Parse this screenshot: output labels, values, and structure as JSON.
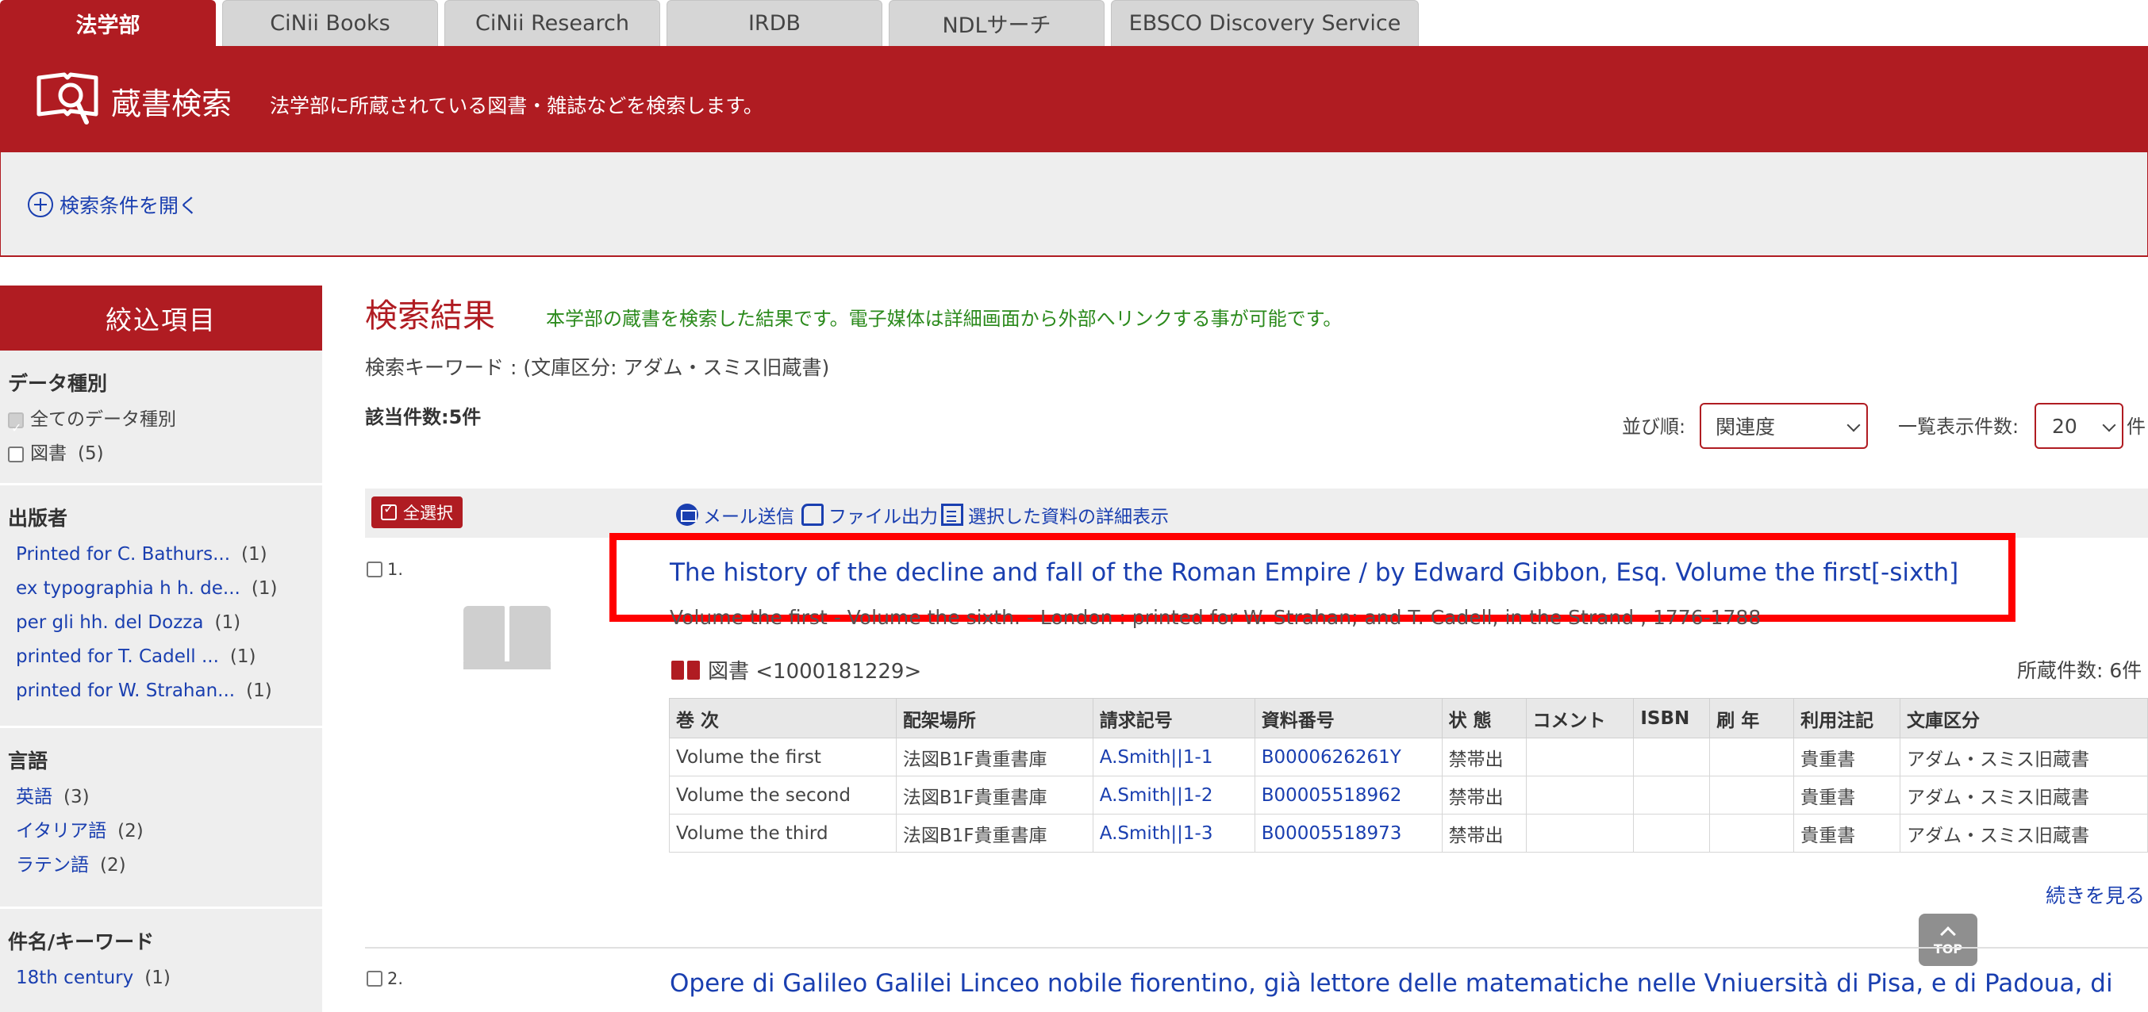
{
  "tabs": [
    {
      "label": "法学部",
      "active": true
    },
    {
      "label": "CiNii Books",
      "active": false
    },
    {
      "label": "CiNii Research",
      "active": false
    },
    {
      "label": "IRDB",
      "active": false
    },
    {
      "label": "NDLサーチ",
      "active": false
    },
    {
      "label": "EBSCO Discovery Service",
      "active": false
    }
  ],
  "header": {
    "title": "蔵書検索",
    "description": "法学部に所蔵されている図書・雑誌などを検索します。",
    "icon": "search-book-icon"
  },
  "conditions": {
    "open_label": "検索条件を開く"
  },
  "sidebar": {
    "heading": "絞込項目",
    "facets": [
      {
        "title": "データ種別",
        "items": [
          {
            "label": "全てのデータ種別",
            "count": "",
            "checkbox": true,
            "checked": true
          },
          {
            "label": "図書",
            "count": "(5)",
            "checkbox": true,
            "checked": false
          }
        ]
      },
      {
        "title": "出版者",
        "items": [
          {
            "label": "Printed for C. Bathurs...",
            "count": "(1)"
          },
          {
            "label": "ex typographia h h. de...",
            "count": "(1)"
          },
          {
            "label": "per gli hh. del Dozza",
            "count": "(1)"
          },
          {
            "label": "printed for T. Cadell ...",
            "count": "(1)"
          },
          {
            "label": "printed for W. Strahan...",
            "count": "(1)"
          }
        ]
      },
      {
        "title": "言語",
        "items": [
          {
            "label": "英語",
            "count": "(3)"
          },
          {
            "label": "イタリア語",
            "count": "(2)"
          },
          {
            "label": "ラテン語",
            "count": "(2)"
          }
        ]
      },
      {
        "title": "件名/キーワード",
        "items": [
          {
            "label": "18th century",
            "count": "(1)"
          }
        ]
      }
    ]
  },
  "results": {
    "title": "検索結果",
    "description": "本学部の蔵書を検索した結果です。電子媒体は詳細画面から外部へリンクする事が可能です。",
    "keyword": "検索キーワード : (文庫区分: アダム・スミス旧蔵書)",
    "count": "該当件数:5件",
    "sort_label": "並び順:",
    "sort_value": "関連度",
    "per_page_label": "一覧表示件数:",
    "per_page_value": "20",
    "per_page_unit": "件"
  },
  "actions": {
    "select_all": "全選択",
    "mail": "メール送信",
    "file_output": "ファイル出力",
    "detail_view": "選択した資料の詳細表示"
  },
  "records": [
    {
      "number": "1.",
      "title": "The history of the decline and fall of the Roman Empire / by Edward Gibbon, Esq. Volume the first[-sixth]",
      "subtitle": "Volume the first - Volume the sixth. - London : printed for W. Strahan; and T. Cadell, in the Strand , 1776-1788",
      "type_label": "図書 <1000181229>",
      "holdings": "所蔵件数: 6件",
      "table_headers": [
        "巻 次",
        "配架場所",
        "請求記号",
        "資料番号",
        "状 態",
        "コメント",
        "ISBN",
        "刷 年",
        "利用注記",
        "文庫区分"
      ],
      "rows": [
        [
          "Volume the first",
          "法図B1F貴重書庫",
          "A.Smith||1-1",
          "B0000626261Y",
          "禁帯出",
          "",
          "",
          "",
          "貴重書",
          "アダム・スミス旧蔵書"
        ],
        [
          "Volume the second",
          "法図B1F貴重書庫",
          "A.Smith||1-2",
          "B00005518962",
          "禁帯出",
          "",
          "",
          "",
          "貴重書",
          "アダム・スミス旧蔵書"
        ],
        [
          "Volume the third",
          "法図B1F貴重書庫",
          "A.Smith||1-3",
          "B00005518973",
          "禁帯出",
          "",
          "",
          "",
          "貴重書",
          "アダム・スミス旧蔵書"
        ]
      ],
      "more": "続きを見る"
    },
    {
      "number": "2.",
      "title": "Opere di Galileo Galilei Linceo nobile fiorentino, già lettore delle matematiche nelle Vniuersità di Pisa, e di Padoua, di"
    }
  ],
  "top_button": "TOP",
  "colors": {
    "accent": "#b01c22",
    "link": "#1a3fb0",
    "highlight": "#ff0000",
    "note_green": "#2b8a1c"
  }
}
